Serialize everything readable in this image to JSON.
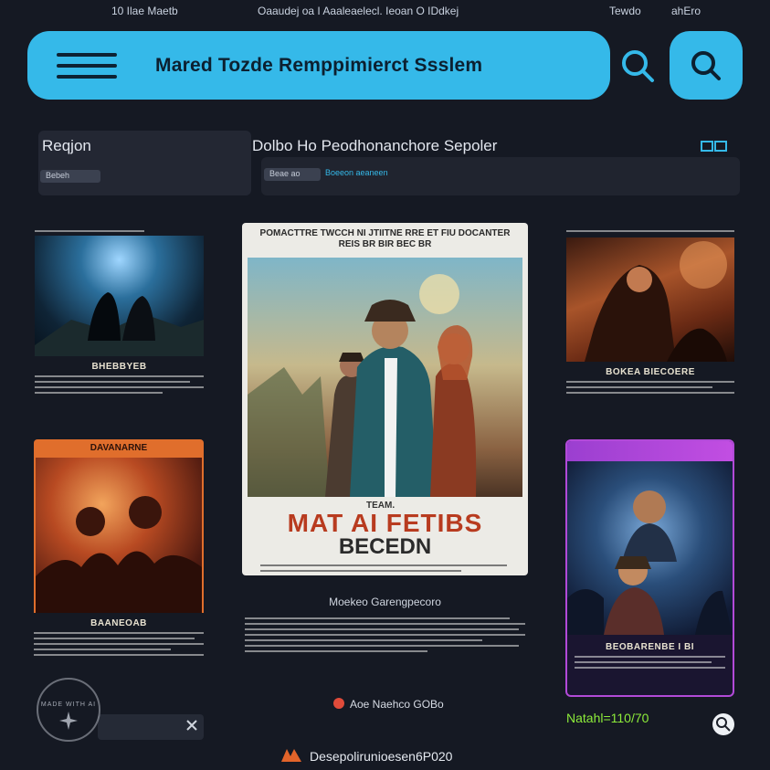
{
  "status_bar": {
    "left": "10  Ilae Maetb",
    "center": "Oaaudej oa I Aaaleaelecl. Ieoan O IDdkej",
    "right1": "Tewdo",
    "right2": "ahEro"
  },
  "header": {
    "title": "Mared Tozde Remppimierct Ssslem"
  },
  "filters": {
    "label": "Reqjon",
    "chip": "Bebeh"
  },
  "section": {
    "title": "Dolbo Ho Peodhonanchore Sepoler",
    "chip": "Beae ao",
    "chip_accent": "Boeeon aeaneen"
  },
  "posters": {
    "top_left": {
      "caption": "BHEBBYEB"
    },
    "featured": {
      "headline1": "POMACTTRE TWCCH NI JTIITNE RRE ET FIU DOCANTER",
      "headline2": "REIS BR BIR BEC BR",
      "tag": "TEAM.",
      "title1": "MAT AI FETIBS",
      "title2": "BECEDN",
      "desc_title": "Moekeo Garengpecoro"
    },
    "top_right": {
      "caption": "BOKEA BIECOERE"
    },
    "bottom_left": {
      "header": "DAVANARNE",
      "caption": "BAANEOAB"
    },
    "bottom_right": {
      "caption": "BEOBARENBE I BI"
    }
  },
  "footer": {
    "link": "Aoe Naehco GOBo",
    "count": "Natahl=110/70",
    "brand_line": "Desepolirunioesen6P020"
  },
  "watermark": "MADE WITH AI"
}
